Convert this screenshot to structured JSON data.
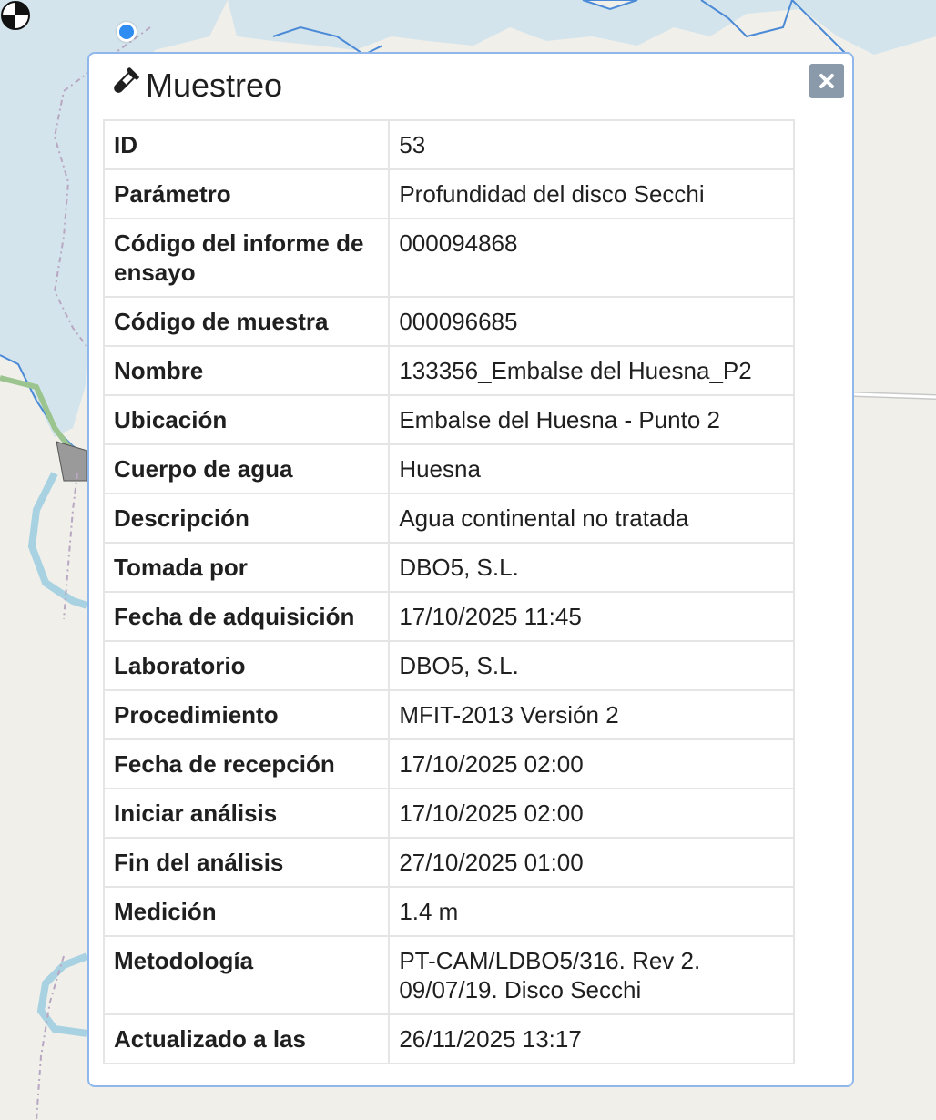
{
  "popup": {
    "title": "Muestreo",
    "close_label": "close",
    "title_icon": "test-tube-icon",
    "rows": [
      {
        "key": "ID",
        "value": "53"
      },
      {
        "key": "Parámetro",
        "value": "Profundidad del disco Secchi"
      },
      {
        "key": "Código del informe de ensayo",
        "value": "000094868"
      },
      {
        "key": "Código de muestra",
        "value": "000096685"
      },
      {
        "key": "Nombre",
        "value": "133356_Embalse del Huesna_P2"
      },
      {
        "key": "Ubicación",
        "value": "Embalse del Huesna - Punto 2"
      },
      {
        "key": "Cuerpo de agua",
        "value": "Huesna"
      },
      {
        "key": "Descripción",
        "value": "Agua continental no tratada"
      },
      {
        "key": "Tomada por",
        "value": "DBO5, S.L."
      },
      {
        "key": "Fecha de adquisición",
        "value": "17/10/2025 11:45"
      },
      {
        "key": "Laboratorio",
        "value": "DBO5, S.L."
      },
      {
        "key": "Procedimiento",
        "value": "MFIT-2013 Versión 2"
      },
      {
        "key": "Fecha de recepción",
        "value": "17/10/2025 02:00"
      },
      {
        "key": "Iniciar análisis",
        "value": "17/10/2025 02:00"
      },
      {
        "key": "Fin del análisis",
        "value": "27/10/2025 01:00"
      },
      {
        "key": "Medición",
        "value": "1.4 m"
      },
      {
        "key": "Metodología",
        "value": "PT-CAM/LDBO5/316. Rev 2. 09/07/19. Disco Secchi"
      },
      {
        "key": "Actualizado a las",
        "value": "26/11/2025 13:17"
      }
    ]
  },
  "map": {
    "water_color": "#d4e4ec",
    "land_color": "#f0efea",
    "marker_color": "#2f8cf0",
    "secchi_icon": "secchi-disk-icon"
  }
}
